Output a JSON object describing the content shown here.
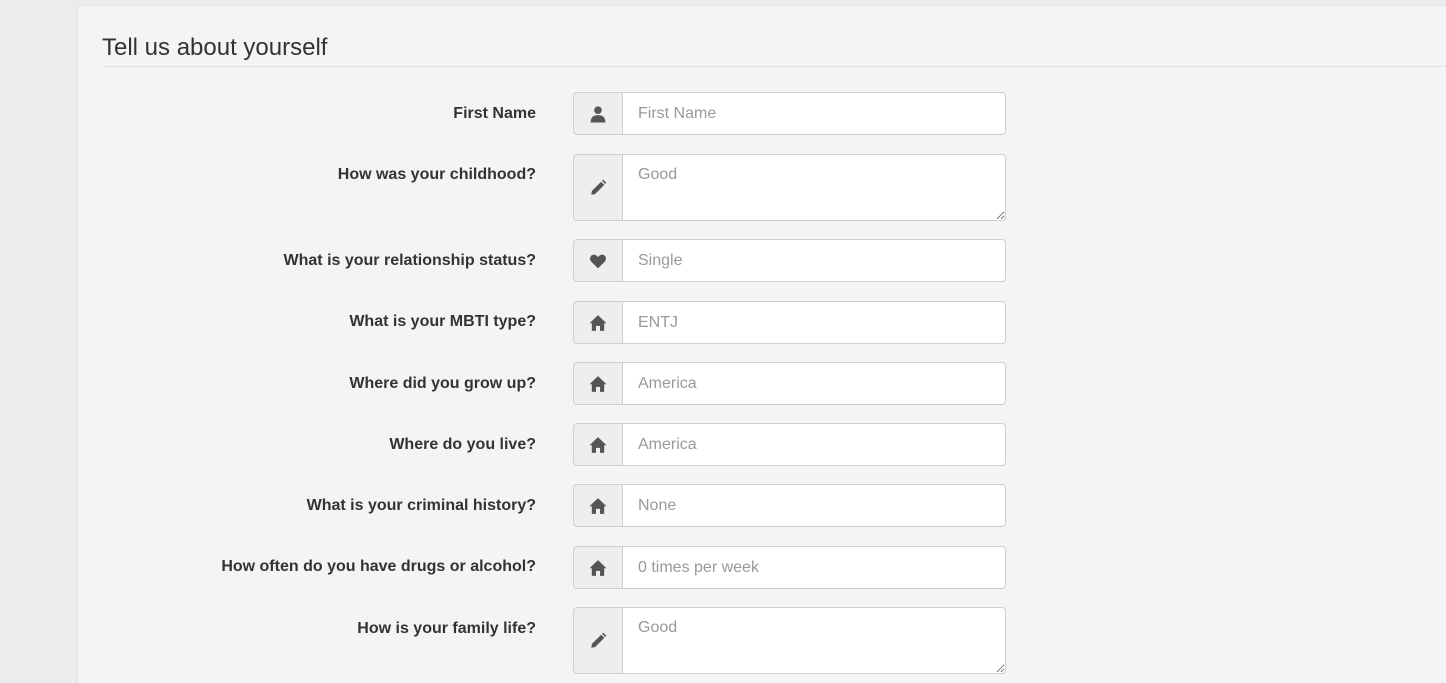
{
  "form": {
    "legend": "Tell us about yourself",
    "fields": [
      {
        "label": "First Name",
        "placeholder": "First Name",
        "icon": "user-icon"
      },
      {
        "label": "How was your childhood?",
        "placeholder": "Good",
        "icon": "pencil-icon"
      },
      {
        "label": "What is your relationship status?",
        "placeholder": "Single",
        "icon": "heart-icon"
      },
      {
        "label": "What is your MBTI type?",
        "placeholder": "ENTJ",
        "icon": "home-icon"
      },
      {
        "label": "Where did you grow up?",
        "placeholder": "America",
        "icon": "home-icon"
      },
      {
        "label": "Where do you live?",
        "placeholder": "America",
        "icon": "home-icon"
      },
      {
        "label": "What is your criminal history?",
        "placeholder": "None",
        "icon": "home-icon"
      },
      {
        "label": "How often do you have drugs or alcohol?",
        "placeholder": "0 times per week",
        "icon": "home-icon"
      },
      {
        "label": "How is your family life?",
        "placeholder": "Good",
        "icon": "pencil-icon"
      }
    ]
  },
  "colors": {
    "icon": "#555555",
    "addon_background": "#eeeeee",
    "panel_background": "#f4f4f4"
  }
}
